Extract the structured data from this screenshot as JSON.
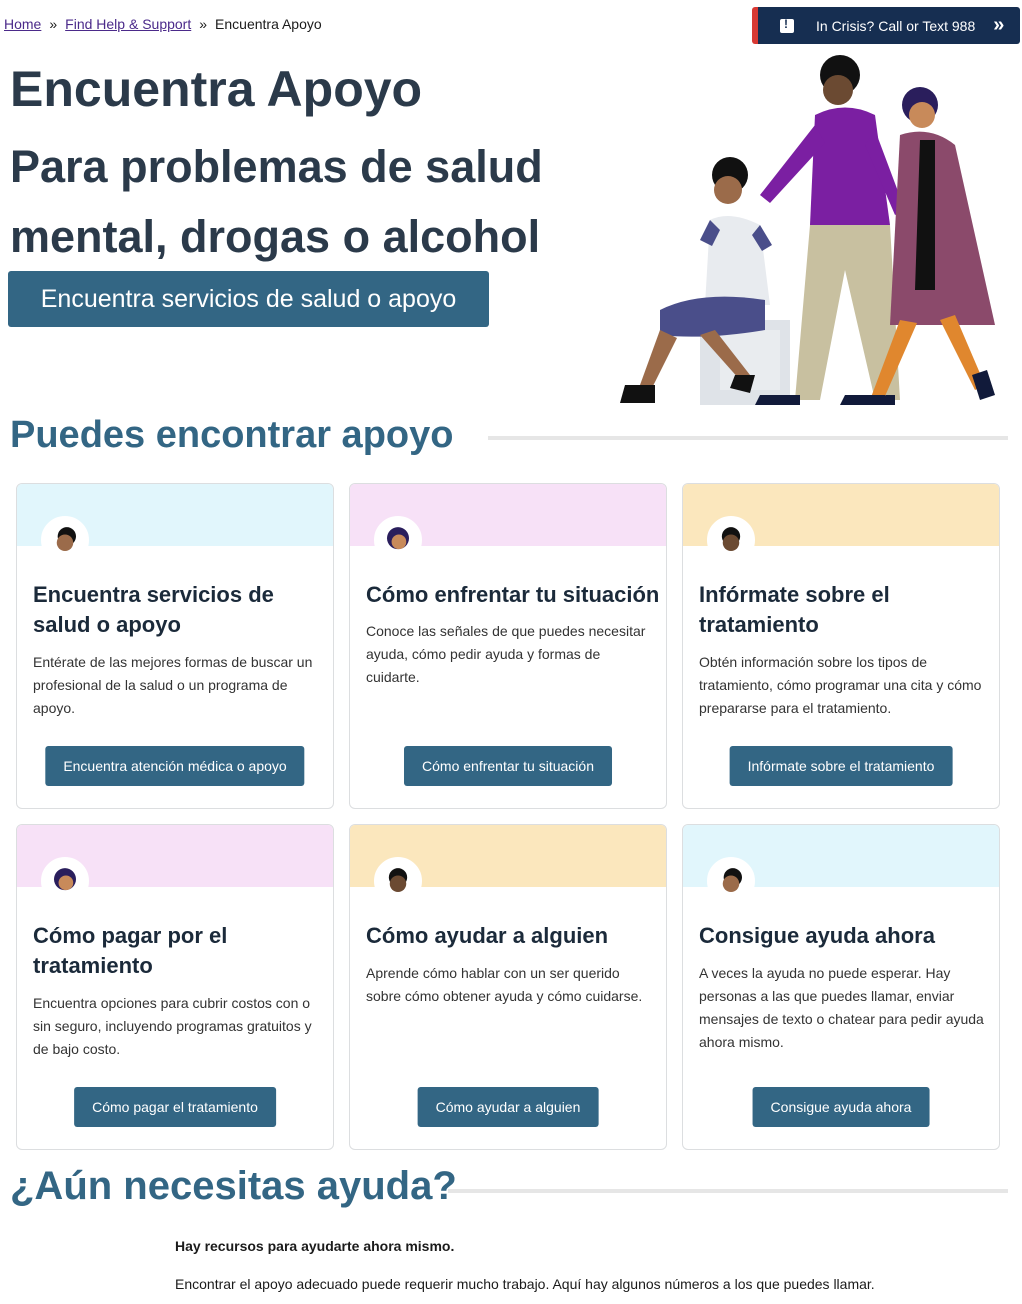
{
  "breadcrumb": {
    "home": "Home",
    "find_help": "Find Help & Support",
    "current": "Encuentra Apoyo",
    "separator": "»"
  },
  "crisis": {
    "label": "In Crisis? Call or Text 988",
    "icon": "alert-icon",
    "chevron": "»"
  },
  "hero": {
    "title": "Encuentra Apoyo",
    "subtitle": "Para problemas de salud mental, drogas o alcohol",
    "button": "Encuentra servicios de salud o apoyo"
  },
  "section1": {
    "heading": "Puedes encontrar apoyo"
  },
  "cards": [
    {
      "title": "Encuentra servicios de salud o apoyo",
      "text": "Entérate de las mejores formas de buscar un profesional de la salud o un programa de apoyo.",
      "button": "Encuentra atención médica o apoyo",
      "band_color": "#e1f6fc"
    },
    {
      "title": "Cómo enfrentar tu situación",
      "text": "Conoce las señales de que puedes necesitar ayuda, cómo pedir ayuda y formas de cuidarte.",
      "button": "Cómo enfrentar tu situación",
      "band_color": "#f7e1f7"
    },
    {
      "title": "Infórmate sobre el tratamiento",
      "text": "Obtén información sobre los tipos de tratamiento, cómo programar una cita y cómo prepararse para el tratamiento.",
      "button": "Infórmate sobre el tratamiento",
      "band_color": "#fbe7bd"
    },
    {
      "title": "Cómo pagar por el tratamiento",
      "text": "Encuentra opciones para cubrir costos con o sin seguro, incluyendo programas gratuitos y de bajo costo.",
      "button": "Cómo pagar el tratamiento",
      "band_color": "#f7e1f7"
    },
    {
      "title": "Cómo ayudar a alguien",
      "text": "Aprende cómo hablar con un ser querido sobre cómo obtener ayuda y cómo cuidarse.",
      "button": "Cómo ayudar a alguien",
      "band_color": "#fbe7bd"
    },
    {
      "title": "Consigue ayuda ahora",
      "text": "A veces la ayuda no puede esperar. Hay personas a las que puedes llamar, enviar mensajes de texto o chatear para pedir ayuda ahora mismo.",
      "button": "Consigue ayuda ahora",
      "band_color": "#e1f6fc"
    }
  ],
  "section2": {
    "heading": "¿Aún necesitas ayuda?",
    "intro_bold": "Hay recursos para ayudarte ahora mismo.",
    "intro": "Encontrar el apoyo adecuado puede requerir mucho trabajo. Aquí hay algunos números a los que puedes llamar."
  }
}
